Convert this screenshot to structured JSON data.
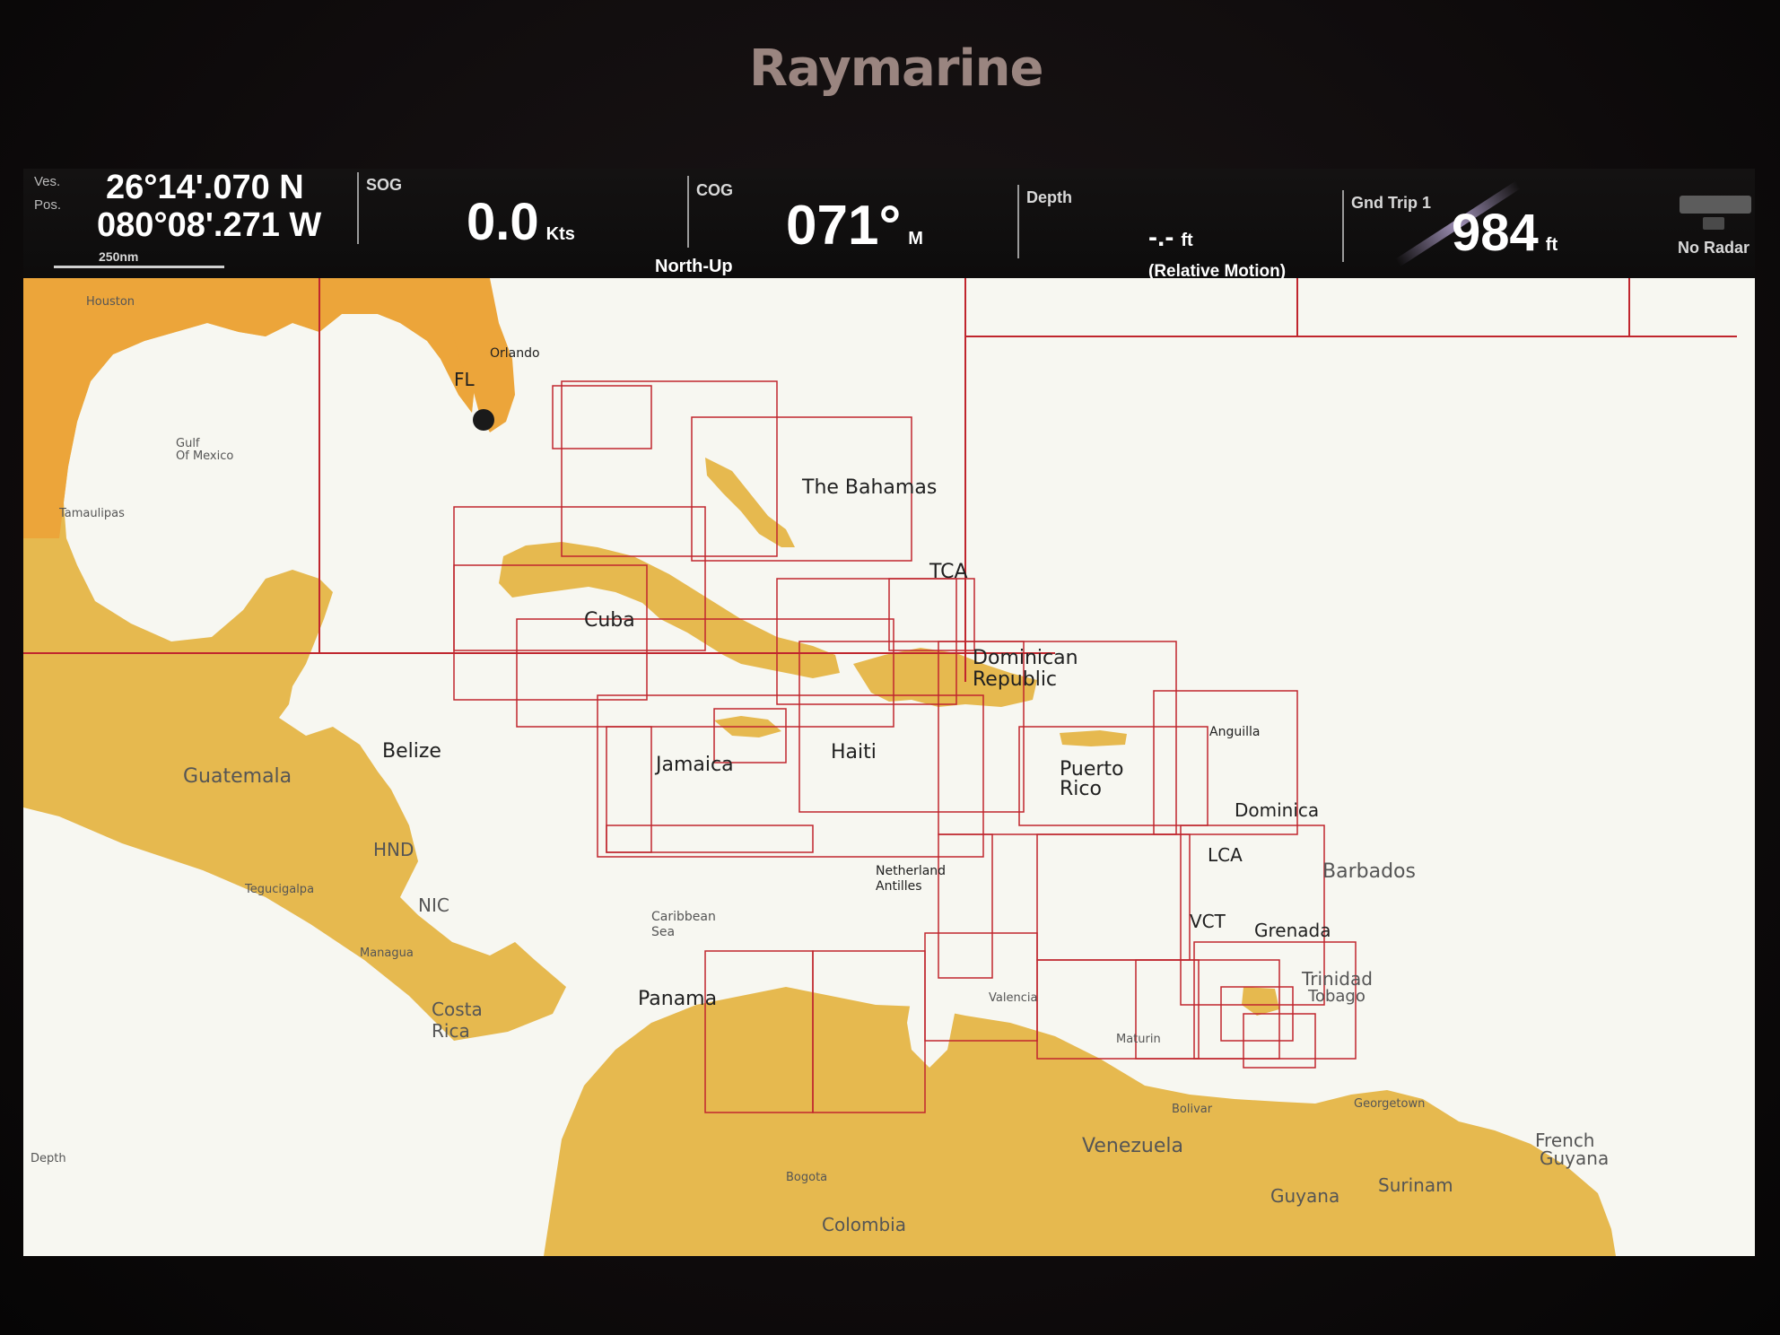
{
  "device": {
    "brand": "Raymarine"
  },
  "databar": {
    "position": {
      "label_line1": "Ves.",
      "label_line2": "Pos.",
      "lat": "26°14'.070 N",
      "lon": "080°08'.271 W",
      "scale": "250nm"
    },
    "sog": {
      "label": "SOG",
      "value": "0.0",
      "unit": "Kts"
    },
    "cog": {
      "label": "COG",
      "value": "071°",
      "unit": "M",
      "mode": "North-Up"
    },
    "depth": {
      "label": "Depth",
      "value": "-.-",
      "unit": "ft",
      "motion": "(Relative Motion)"
    },
    "trip": {
      "label": "Gnd Trip 1",
      "value": "984",
      "unit": "ft"
    },
    "radar": {
      "label": "No Radar",
      "icon": "radar-icon"
    }
  },
  "map": {
    "water_color": "#f7f7f1",
    "land_color": "#e6b94f",
    "land_highlight_color": "#eca53a",
    "chart_border_color": "#c0262e",
    "vessel_icon": "vessel-position-icon",
    "places": {
      "houston": "Houston",
      "orlando": "Orlando",
      "fl": "FL",
      "gulf1": "Gulf",
      "gulf2": "Of Mexico",
      "tamaulipas": "Tamaulipas",
      "bahamas": "The Bahamas",
      "tca": "TCA",
      "cuba": "Cuba",
      "dominican1": "Dominican",
      "dominican2": "Republic",
      "belize": "Belize",
      "guatemala": "Guatemala",
      "jamaica": "Jamaica",
      "haiti": "Haiti",
      "puertorico1": "Puerto",
      "puertorico2": "Rico",
      "anguilla": "Anguilla",
      "dominica": "Dominica",
      "hnd": "HND",
      "lca": "LCA",
      "barbados": "Barbados",
      "tegucigalpa": "Tegucigalpa",
      "nic": "NIC",
      "netherlands1": "Netherland",
      "netherlands2": "Antilles",
      "caribbean1": "Caribbean",
      "caribbean2": "Sea",
      "vct": "VCT",
      "grenada": "Grenada",
      "managua": "Managua",
      "trinidad": "Trinidad",
      "tobago": "Tobago",
      "panama": "Panama",
      "costarica1": "Costa",
      "costarica2": "Rica",
      "valencia": "Valencia",
      "maturin": "Maturin",
      "georgetown": "Georgetown",
      "bolivar": "Bolivar",
      "venezuela": "Venezuela",
      "french1": "French",
      "french2": "Guyana",
      "bogota": "Bogota",
      "guyana": "Guyana",
      "surinam": "Surinam",
      "colombia": "Colombia",
      "depth_tag": "Depth"
    }
  }
}
